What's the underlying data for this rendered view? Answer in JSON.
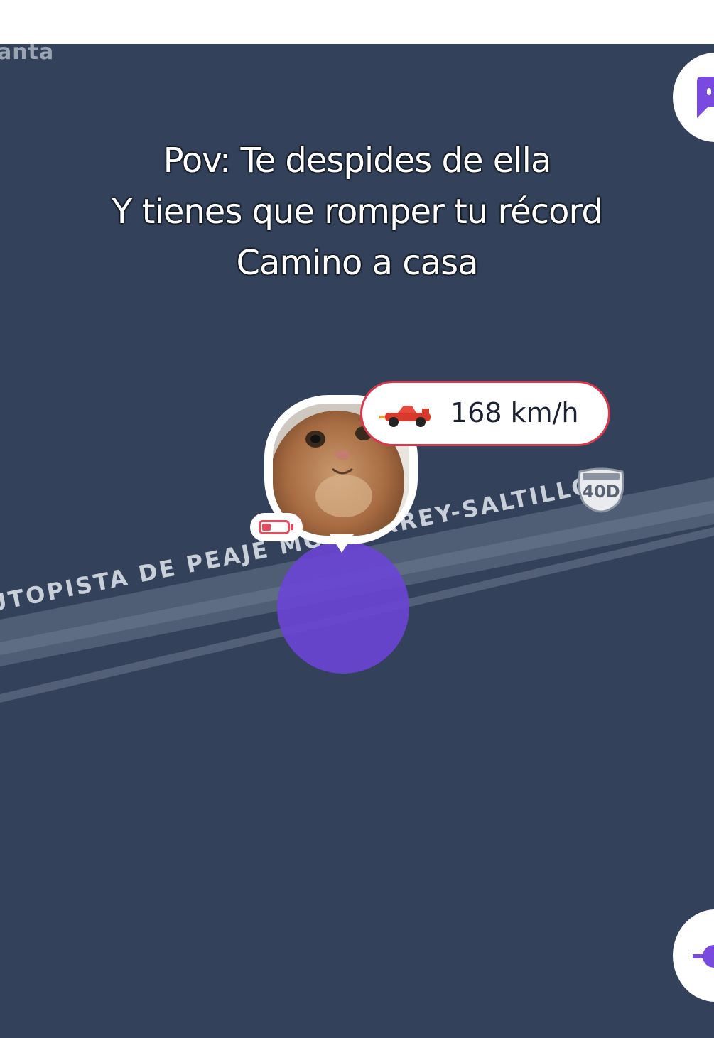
{
  "map": {
    "corner_label": "anta",
    "road_label": "UTOPISTA DE PEAJE MONTERREY-SALTILLO",
    "highway_shield": "40D",
    "colors": {
      "background": "#33425a",
      "road": "#5c6a80",
      "accent": "#6a45d6"
    }
  },
  "caption": {
    "line1": "Pov: Te despides de ella",
    "line2": "Y tienes que romper tu récord",
    "line3": "Camino a casa"
  },
  "user_marker": {
    "avatar": "cat-photo",
    "battery": "low-battery-icon",
    "speed": "168 km/h",
    "speed_icon": "race-car-icon"
  },
  "buttons": {
    "top_right": "chat-icon",
    "bottom_right": "locate-icon"
  }
}
